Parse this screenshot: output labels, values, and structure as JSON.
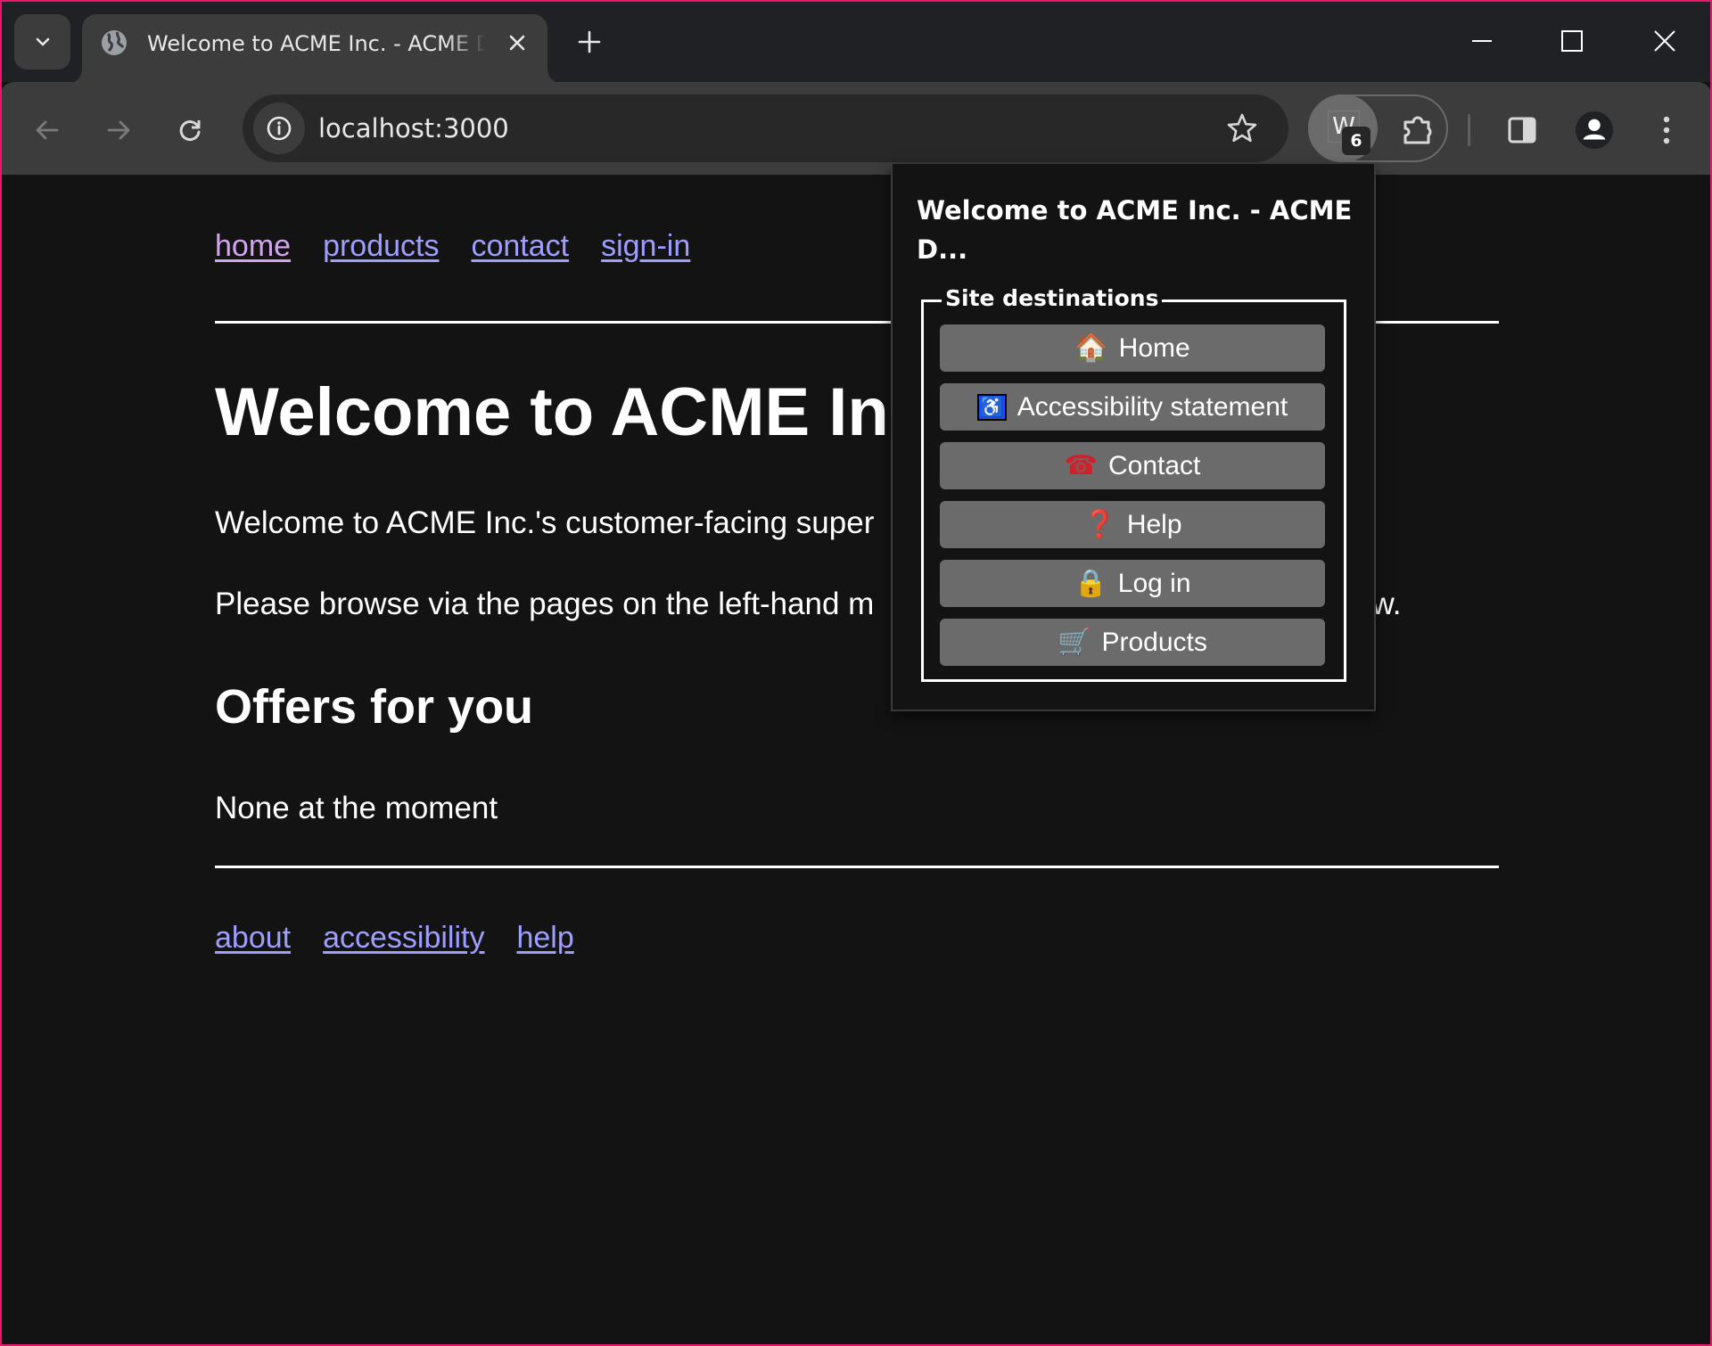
{
  "browser": {
    "tab": {
      "title": "Welcome to ACME Inc. - ACME Dashboard",
      "favicon": "globe-icon",
      "close_icon": "close-icon"
    },
    "new_tab_icon": "plus-icon",
    "window_controls": {
      "minimize_icon": "minimize-icon",
      "maximize_icon": "maximize-icon",
      "close_icon": "close-icon"
    },
    "toolbar": {
      "back_icon": "arrow-left-icon",
      "forward_icon": "arrow-right-icon",
      "reload_icon": "reload-icon",
      "site_info_icon": "info-icon",
      "url": "localhost:3000",
      "bookmark_icon": "star-icon",
      "extension": {
        "letter": "W",
        "badge_count": "6"
      },
      "extensions_icon": "puzzle-icon",
      "side_panel_icon": "side-panel-icon",
      "profile_icon": "person-icon",
      "menu_icon": "more-vertical-icon"
    }
  },
  "page": {
    "nav_links": [
      {
        "label": "home",
        "visited": true
      },
      {
        "label": "products",
        "visited": false
      },
      {
        "label": "contact",
        "visited": false
      },
      {
        "label": "sign-in",
        "visited": false
      }
    ],
    "heading": "Welcome to ACME Inc",
    "paragraphs": [
      "Welcome to ACME Inc.'s customer-facing super",
      "Please browse via the pages on the left-hand m",
      "ow."
    ],
    "offers_heading": "Offers for you",
    "offers_text": "None at the moment",
    "footer_links": [
      {
        "label": "about"
      },
      {
        "label": "accessibility"
      },
      {
        "label": "help"
      }
    ]
  },
  "popup": {
    "title": "Welcome to ACME Inc. - ACME D...",
    "legend": "Site destinations",
    "destinations": [
      {
        "label": "Home",
        "icon": "house-icon",
        "glyph": "🏠"
      },
      {
        "label": "Accessibility statement",
        "icon": "wheelchair-icon",
        "glyph": "♿"
      },
      {
        "label": "Contact",
        "icon": "telephone-icon",
        "glyph": "☎"
      },
      {
        "label": "Help",
        "icon": "question-mark-icon",
        "glyph": "❓"
      },
      {
        "label": "Log in",
        "icon": "lock-icon",
        "glyph": "🔒"
      },
      {
        "label": "Products",
        "icon": "shopping-cart-icon",
        "glyph": "🛒"
      }
    ]
  },
  "colors": {
    "link": "#9e9eff",
    "visited_link": "#d3a4f0",
    "page_background": "#131313",
    "window_border": "#e8186a",
    "button_background": "#6b6b6b"
  }
}
